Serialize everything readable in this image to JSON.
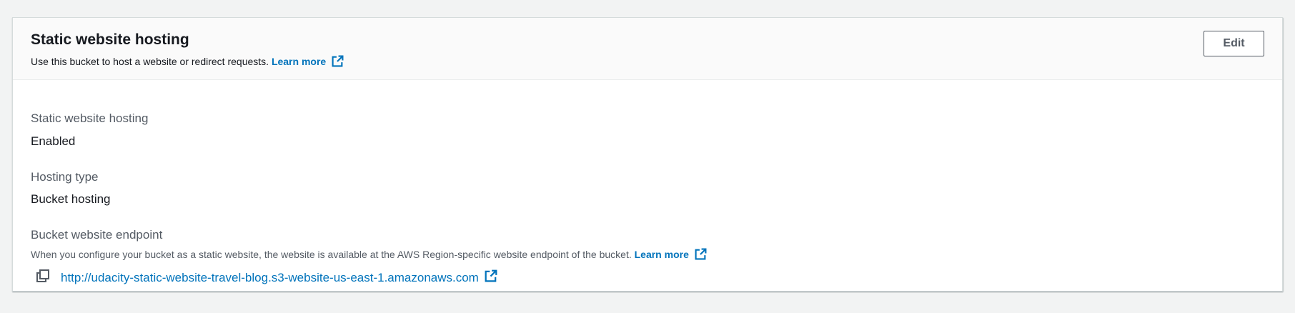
{
  "header": {
    "title": "Static website hosting",
    "description": "Use this bucket to host a website or redirect requests.",
    "learn_more": "Learn more",
    "edit_label": "Edit"
  },
  "fields": {
    "hosting": {
      "label": "Static website hosting",
      "value": "Enabled"
    },
    "hosting_type": {
      "label": "Hosting type",
      "value": "Bucket hosting"
    },
    "endpoint": {
      "label": "Bucket website endpoint",
      "description": "When you configure your bucket as a static website, the website is available at the AWS Region-specific website endpoint of the bucket.",
      "learn_more": "Learn more",
      "url": "http://udacity-static-website-travel-blog.s3-website-us-east-1.amazonaws.com"
    }
  },
  "icons": {
    "external_link": "external-link-icon",
    "copy": "copy-icon"
  },
  "colors": {
    "link": "#0073bb",
    "text": "#16191f",
    "label": "#545b64",
    "background": "#f2f3f3"
  }
}
